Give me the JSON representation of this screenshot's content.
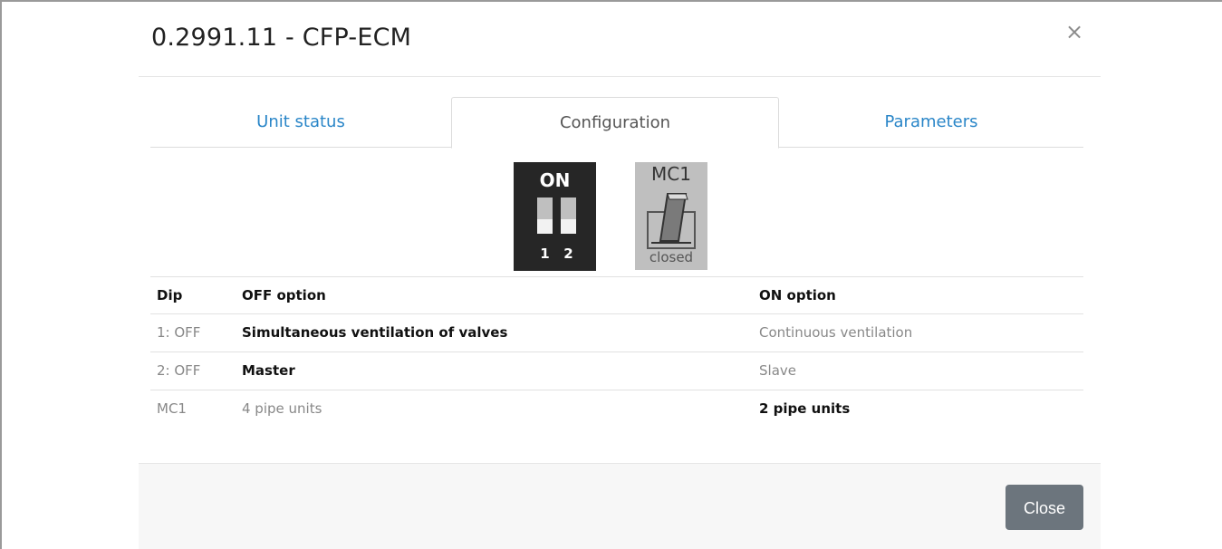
{
  "modal": {
    "title": "0.2991.11 - CFP-ECM",
    "close_glyph": "×"
  },
  "tabs": [
    {
      "label": "Unit status",
      "active": false
    },
    {
      "label": "Configuration",
      "active": true
    },
    {
      "label": "Parameters",
      "active": false
    }
  ],
  "dip_switch": {
    "on_label": "ON",
    "switches": [
      {
        "number": "1",
        "state": "OFF"
      },
      {
        "number": "2",
        "state": "OFF"
      }
    ]
  },
  "mc1_switch": {
    "label": "MC1",
    "state": "closed"
  },
  "table": {
    "headers": [
      "Dip",
      "OFF option",
      "ON option"
    ],
    "rows": [
      {
        "dip": "1: OFF",
        "off_option": "Simultaneous ventilation of valves",
        "on_option": "Continuous ventilation",
        "selected": "off"
      },
      {
        "dip": "2: OFF",
        "off_option": "Master",
        "on_option": "Slave",
        "selected": "off"
      },
      {
        "dip": "MC1",
        "off_option": "4 pipe units",
        "on_option": "2 pipe units",
        "selected": "on"
      }
    ]
  },
  "footer": {
    "close_label": "Close"
  },
  "colors": {
    "link": "#2a86c8",
    "close_button": "#6c757d",
    "dip_background": "#262626",
    "mc_background": "#bfbfbf"
  },
  "icons": {
    "close": "close-icon",
    "mc1": "toggle-switch-icon"
  }
}
